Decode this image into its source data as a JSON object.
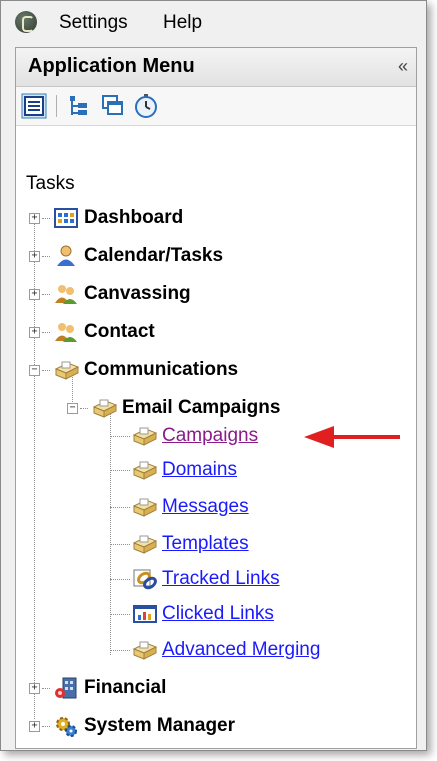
{
  "menubar": {
    "settings": "Settings",
    "help": "Help"
  },
  "panel": {
    "title": "Application Menu",
    "collapse": "«"
  },
  "tasks_label": "Tasks",
  "tree": {
    "dashboard": "Dashboard",
    "calendar": "Calendar/Tasks",
    "canvassing": "Canvassing",
    "contact": "Contact",
    "communications": "Communications",
    "email_campaigns": "Email Campaigns",
    "campaigns": "Campaigns",
    "domains": "Domains",
    "messages": "Messages",
    "templates": "Templates",
    "tracked_links": "Tracked Links",
    "clicked_links": "Clicked Links",
    "advanced_merging": "Advanced Merging",
    "financial": "Financial",
    "system_manager": "System Manager"
  },
  "colors": {
    "link": "#1a1aff",
    "visited": "#8b1a8b",
    "arrow": "#e02020"
  }
}
